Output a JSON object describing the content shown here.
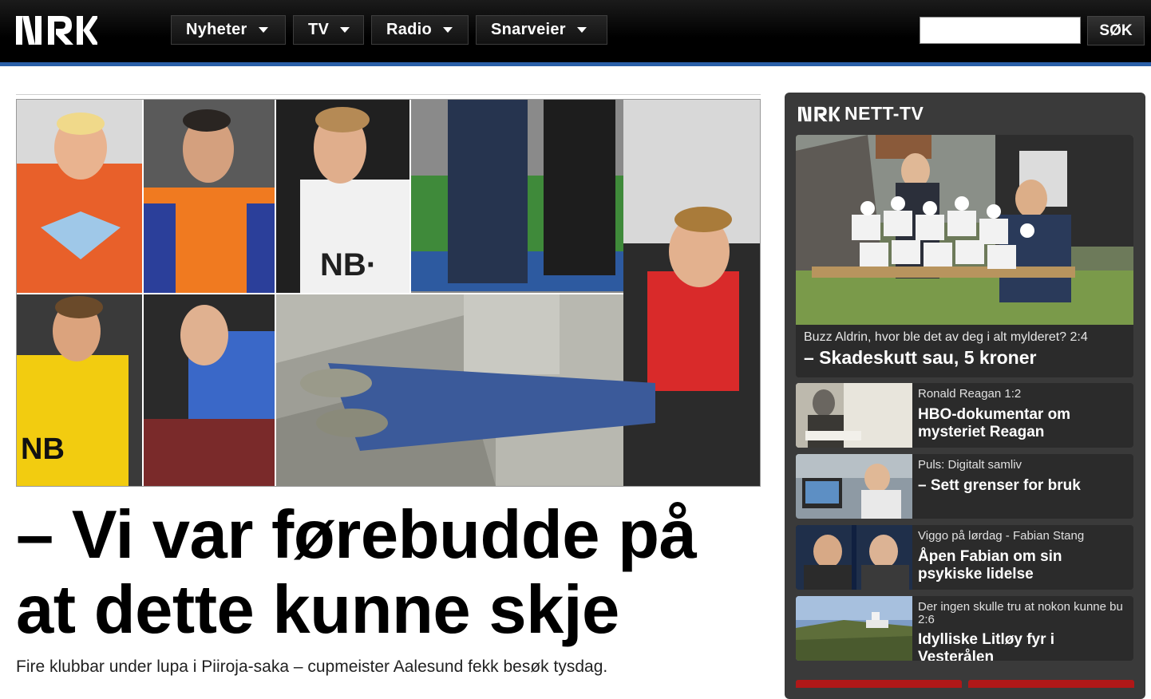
{
  "header": {
    "logo": "NRK",
    "nav": [
      {
        "label": "Nyheter"
      },
      {
        "label": "TV"
      },
      {
        "label": "Radio"
      },
      {
        "label": "Snarveier"
      }
    ],
    "search_placeholder": "",
    "search_button": "SØK",
    "accent_color": "#2a5fa8"
  },
  "main": {
    "headline": "– Vi var førebudde på at dette kunne skje",
    "lead": "Fire klubbar under lupa i Piiroja-saka – cupmeister Aalesund fekk besøk tysdag."
  },
  "nett_tv": {
    "logo": "NRK",
    "title": "NETT-TV",
    "feature": {
      "kicker": "Buzz Aldrin, hvor ble det av deg i alt mylderet? 2:4",
      "title": "– Skadeskutt sau, 5 kroner"
    },
    "items": [
      {
        "kicker": "Ronald Reagan 1:2",
        "title": "HBO-dokumentar om mysteriet Reagan"
      },
      {
        "kicker": "Puls: Digitalt samliv",
        "title": "– Sett grenser for bruk"
      },
      {
        "kicker": "Viggo på lørdag - Fabian Stang",
        "title": "Åpen Fabian om sin psykiske lidelse"
      },
      {
        "kicker": "Der ingen skulle tru at nokon kunne bu 2:6",
        "title": "Idylliske Litløy fyr i Vesterålen"
      }
    ]
  }
}
